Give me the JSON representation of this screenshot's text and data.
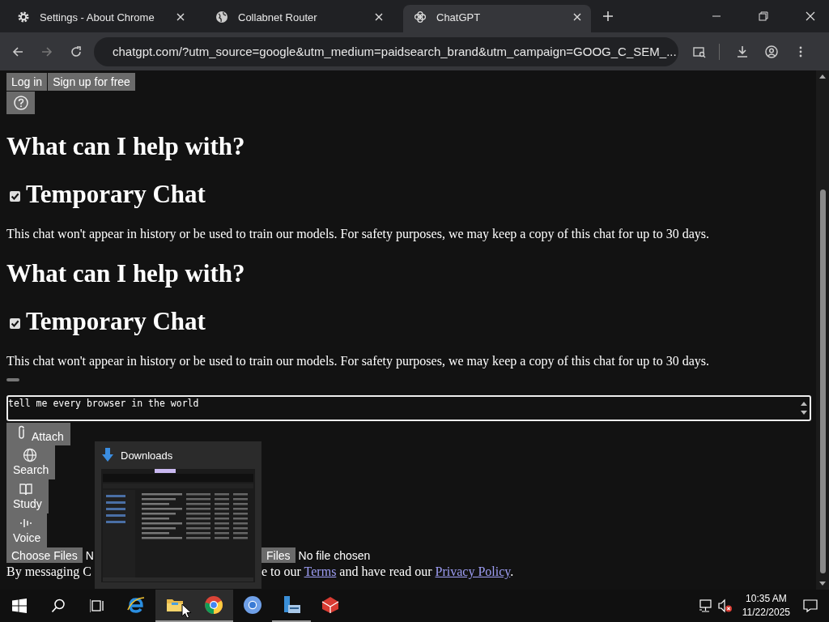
{
  "browser": {
    "tabs": [
      {
        "title": "Settings - About Chrome",
        "kind": "settings",
        "selected": false
      },
      {
        "title": "Collabnet Router",
        "kind": "site",
        "selected": false
      },
      {
        "title": "ChatGPT",
        "kind": "chat",
        "selected": true
      }
    ],
    "address": "chatgpt.com/?utm_source=google&utm_medium=paidsearch_brand&utm_campaign=GOOG_C_SEM_..."
  },
  "page": {
    "header_buttons": [
      "Log in",
      "Sign up for free"
    ],
    "sections": [
      {
        "heading": "What can I help with?",
        "temporary_chat": {
          "label": "Temporary Chat",
          "checked": true
        },
        "notice": "This chat won't appear in history or be used to train our models. For safety purposes, we may keep a copy of this chat for up to 30 days."
      },
      {
        "heading": "What can I help with?",
        "temporary_chat": {
          "label": "Temporary Chat",
          "checked": true
        },
        "notice": "This chat won't appear in history or be used to train our models. For safety purposes, we may keep a copy of this chat for up to 30 days."
      }
    ],
    "prompt": {
      "value": "tell me every browser in the world"
    },
    "tools": [
      {
        "label": "Attach",
        "kind": "attach"
      },
      {
        "label": "Search",
        "kind": "search"
      },
      {
        "label": "Study",
        "kind": "study"
      },
      {
        "label": "Voice",
        "kind": "voice"
      }
    ],
    "file_inputs": [
      {
        "button": "Choose Files",
        "status": "N"
      },
      {
        "button": "Files",
        "status": "No file chosen"
      }
    ],
    "footer": {
      "start": "By messaging C",
      "parts": [
        {
          "text": "e to our "
        },
        {
          "link": "Terms"
        },
        {
          "text": " and have read our "
        },
        {
          "link": "Privacy Policy"
        },
        {
          "text": "."
        }
      ]
    }
  },
  "preview": {
    "title": "Downloads"
  },
  "taskbar": {
    "apps": [
      {
        "kind": "ie",
        "running": false,
        "highlighted": false
      },
      {
        "kind": "folder",
        "running": true,
        "highlighted": true
      },
      {
        "kind": "chrome",
        "running": true,
        "highlighted": true
      },
      {
        "kind": "chromium",
        "running": false,
        "highlighted": false
      },
      {
        "kind": "server",
        "running": true,
        "highlighted": false
      },
      {
        "kind": "cube",
        "running": false,
        "highlighted": false
      }
    ],
    "time": "10:35 AM",
    "date": "11/22/2025"
  }
}
